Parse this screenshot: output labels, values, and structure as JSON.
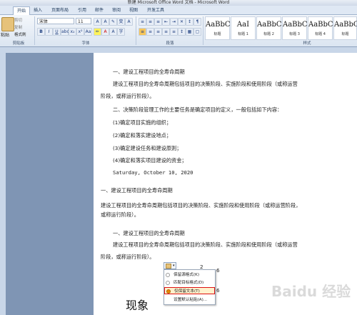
{
  "window": {
    "title": "新建 Microsoft Office Word 文档 - Microsoft Word"
  },
  "tabs": [
    "开始",
    "插入",
    "页面布局",
    "引用",
    "邮件",
    "审阅",
    "视图",
    "开发工具"
  ],
  "ribbon": {
    "clipboard": {
      "paste": "粘贴",
      "cut": "剪切",
      "copy": "复制",
      "format_painter": "格式刷",
      "label": "剪贴板"
    },
    "font": {
      "name": "宋体",
      "size": "11",
      "label": "字体"
    },
    "paragraph": {
      "label": "段落"
    },
    "styles": {
      "label": "样式",
      "items": [
        {
          "sample": "AaBbC",
          "caption": "标题"
        },
        {
          "sample": "AaI",
          "caption": "标题 1"
        },
        {
          "sample": "AaBbC",
          "caption": "标题 2"
        },
        {
          "sample": "AaBbC",
          "caption": "标题 3"
        },
        {
          "sample": "AaBbC",
          "caption": "标题 4"
        },
        {
          "sample": "AaBbC",
          "caption": "标题"
        }
      ]
    }
  },
  "document": {
    "lines": [
      "一、建设工程项目的全寿命周期",
      "建设工程项目的全寿命周期包括项目的决策阶段、实施阶段和使用阶段（或称运营",
      "阶段，或称运行阶段）。",
      "二、决策阶段管理工作的主要任务是确定项目的定义，一般包括如下内容：",
      "(1)确定项目实施的组织；",
      "(2)确定和落实建设地点；",
      "(3)确定建设任务和建设原则；",
      "(4)确定和落实项目建设的资金；",
      "Saturday, October 10, 2020",
      "一、建设工程项目的全寿命周期",
      "建设工程项目的全寿命周期包括项目的决策阶段、实施阶段和使用阶段（或称运营阶段，",
      "或称运行阶段）。",
      "一、建设工程项目的全寿命周期",
      "建设工程项目的全寿命周期包括项目的决策阶段、实施阶段和使用阶段（或称运营",
      "阶段，或称运行阶段）。"
    ],
    "fragments": [
      "2",
      "6",
      "6",
      "现象"
    ]
  },
  "paste_menu": {
    "items": [
      {
        "label": "保留源格式(K)",
        "selected": false
      },
      {
        "label": "匹配目标格式(D)",
        "selected": false
      },
      {
        "label": "仅保留文本(T)",
        "selected": true
      },
      {
        "label": "设置默认粘贴(A)...",
        "selected": false
      }
    ]
  },
  "watermark": "Baidu 经验"
}
